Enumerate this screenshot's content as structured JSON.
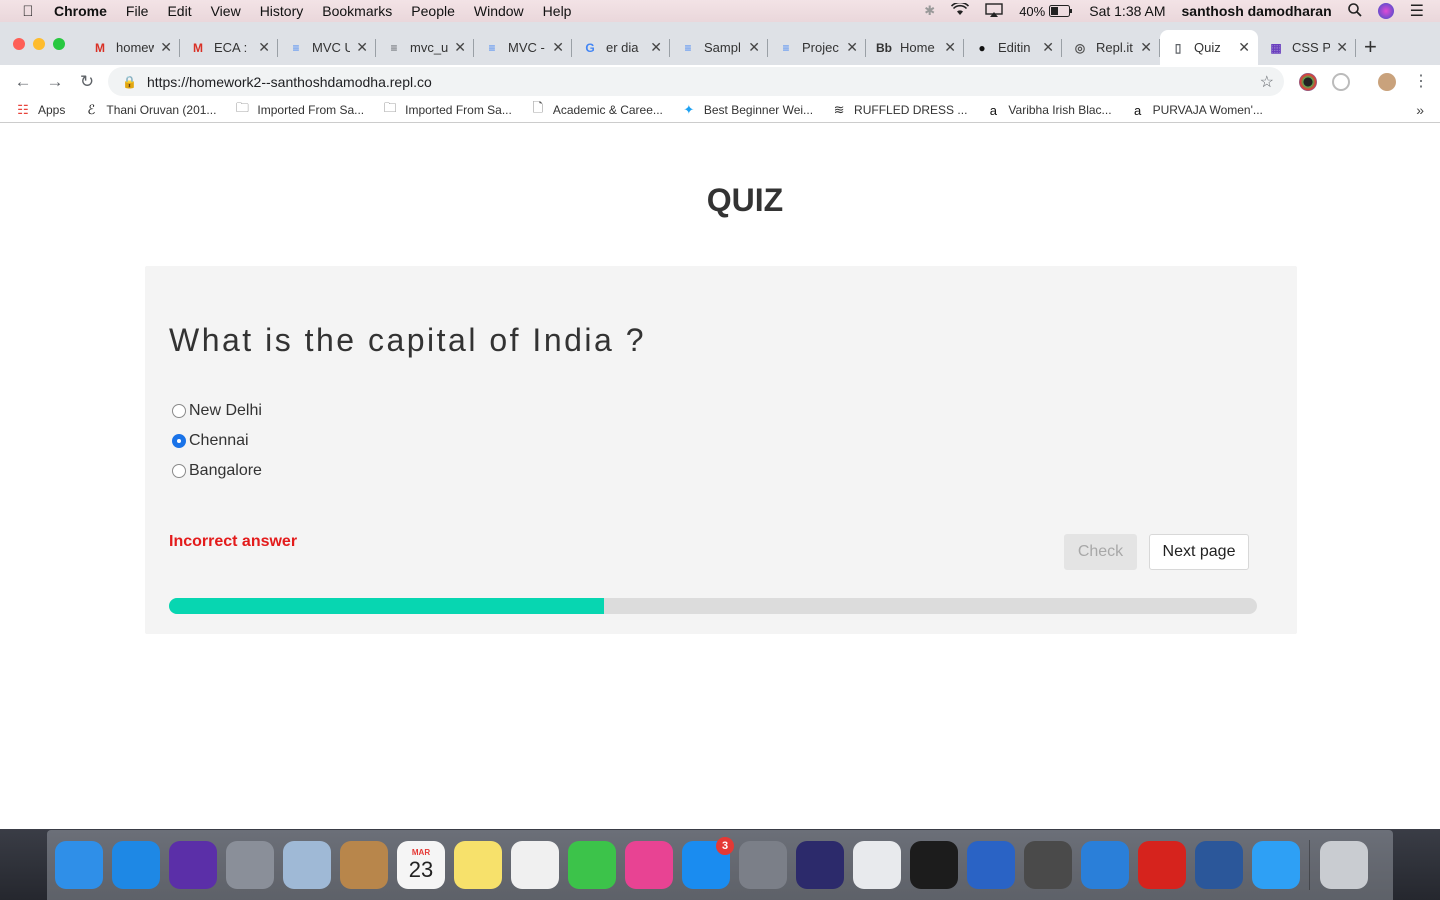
{
  "menubar": {
    "app_name": "Chrome",
    "menus": [
      "File",
      "Edit",
      "View",
      "History",
      "Bookmarks",
      "People",
      "Window",
      "Help"
    ],
    "battery": "40%",
    "clock": "Sat 1:38 AM",
    "user": "santhosh damodharan"
  },
  "tabs": [
    {
      "title": "homew",
      "icon": "gmail-icon",
      "color": "#d93025",
      "glyph": "M"
    },
    {
      "title": "ECA :",
      "icon": "gmail-icon",
      "color": "#d93025",
      "glyph": "M"
    },
    {
      "title": "MVC U",
      "icon": "docs-icon",
      "color": "#4285f4",
      "glyph": "≡"
    },
    {
      "title": "mvc_u",
      "icon": "drive-file-icon",
      "color": "#5f6368",
      "glyph": "≡"
    },
    {
      "title": "MVC -",
      "icon": "docs-icon",
      "color": "#4285f4",
      "glyph": "≡"
    },
    {
      "title": "er dia",
      "icon": "google-icon",
      "color": "#4285f4",
      "glyph": "G"
    },
    {
      "title": "Sampl",
      "icon": "docs-icon",
      "color": "#4285f4",
      "glyph": "≡"
    },
    {
      "title": "Projec",
      "icon": "docs-icon",
      "color": "#4285f4",
      "glyph": "≡"
    },
    {
      "title": "Home",
      "icon": "blackboard-icon",
      "color": "#333333",
      "glyph": "Bb"
    },
    {
      "title": "Editin",
      "icon": "github-icon",
      "color": "#111111",
      "glyph": "●"
    },
    {
      "title": "Repl.it",
      "icon": "replit-icon",
      "color": "#555555",
      "glyph": "◎"
    },
    {
      "title": "Quiz",
      "icon": "page-icon",
      "color": "#5f6368",
      "glyph": "▯",
      "active": true
    },
    {
      "title": "CSS P",
      "icon": "w3schools-icon",
      "color": "#6a3fbf",
      "glyph": "▦"
    }
  ],
  "address_bar": {
    "url": "https://homework2--santhoshdamodha.repl.co"
  },
  "bookmarks": [
    {
      "label": "Apps",
      "icon": "apps-grid-icon"
    },
    {
      "label": "Thani Oruvan (201...",
      "icon": "script-e-icon"
    },
    {
      "label": "Imported From Sa...",
      "icon": "folder-icon"
    },
    {
      "label": "Imported From Sa...",
      "icon": "folder-icon"
    },
    {
      "label": "Academic & Caree...",
      "icon": "page-icon"
    },
    {
      "label": "Best Beginner Wei...",
      "icon": "bird-icon"
    },
    {
      "label": "RUFFLED DRESS ...",
      "icon": "brand-icon"
    },
    {
      "label": "Varibha Irish Blac...",
      "icon": "amazon-icon"
    },
    {
      "label": "PURVAJA Women'...",
      "icon": "amazon-icon"
    }
  ],
  "quiz": {
    "heading": "QUIZ",
    "question": "What is the capital of India ?",
    "options": [
      {
        "label": "New Delhi",
        "selected": false
      },
      {
        "label": "Chennai",
        "selected": true
      },
      {
        "label": "Bangalore",
        "selected": false
      }
    ],
    "feedback": "Incorrect answer",
    "check_label": "Check",
    "next_label": "Next page",
    "progress": 0.4
  },
  "dock": [
    {
      "name": "finder-icon",
      "color": "#2f8fe8"
    },
    {
      "name": "safari-icon",
      "color": "#1e88e5"
    },
    {
      "name": "siri-icon",
      "color": "#5b2fa8"
    },
    {
      "name": "launchpad-icon",
      "color": "#8a8f99"
    },
    {
      "name": "mail-icon",
      "color": "#9fb9d6"
    },
    {
      "name": "contacts-icon",
      "color": "#b8864b"
    },
    {
      "name": "calendar-icon",
      "color": "#f5f5f5",
      "text": "23",
      "subtext": "MAR"
    },
    {
      "name": "notes-icon",
      "color": "#f7e16b"
    },
    {
      "name": "photos-icon",
      "color": "#f0f0f0"
    },
    {
      "name": "facetime-icon",
      "color": "#3cc34a"
    },
    {
      "name": "itunes-icon",
      "color": "#e84393"
    },
    {
      "name": "app-store-icon",
      "color": "#1a8cf0",
      "badge": "3"
    },
    {
      "name": "system-preferences-icon",
      "color": "#7b7f88"
    },
    {
      "name": "eclipse-icon",
      "color": "#2c2a6b"
    },
    {
      "name": "chrome-icon",
      "color": "#e8eaed"
    },
    {
      "name": "terminal-icon",
      "color": "#1c1c1c"
    },
    {
      "name": "cyberduck-icon",
      "color": "#2a63c5"
    },
    {
      "name": "sublime-text-icon",
      "color": "#4a4a4a"
    },
    {
      "name": "brackets-icon",
      "color": "#2a7fd9"
    },
    {
      "name": "acrobat-icon",
      "color": "#d6231d"
    },
    {
      "name": "word-icon",
      "color": "#2b579a"
    },
    {
      "name": "messages-icon",
      "color": "#2ea0f5"
    },
    {
      "name": "trash-icon",
      "color": "#c9ccd1"
    }
  ]
}
